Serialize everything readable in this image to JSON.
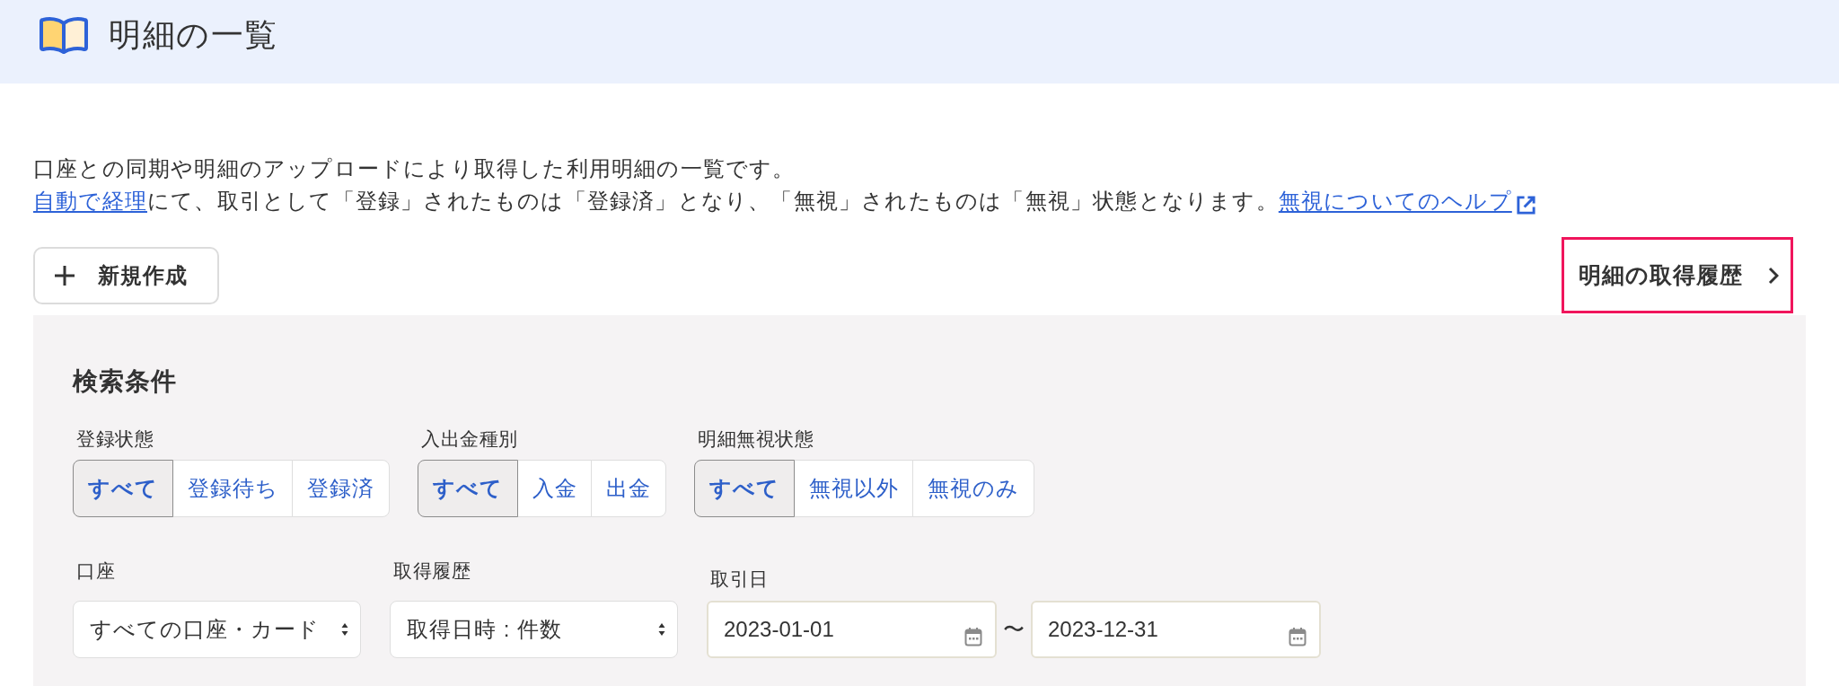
{
  "header": {
    "title": "明細の一覧"
  },
  "intro": {
    "lines": [
      [
        {
          "kind": "text",
          "text": "口座との同期や明細のアップロードにより取得した利用明細の一覧です。"
        }
      ],
      [
        {
          "kind": "link",
          "text": "自動で経理"
        },
        {
          "kind": "text",
          "text": "にて、取引として「登録」されたものは「登録済」となり、「無視」されたものは「無視」状態となります。"
        },
        {
          "kind": "external_link",
          "text": "無視についてのヘルプ"
        }
      ]
    ]
  },
  "actions": {
    "new_button": {
      "label": "新規作成"
    },
    "history_link": {
      "label": "明細の取得履歴",
      "highlighted": true
    }
  },
  "search": {
    "title": "検索条件",
    "filters": [
      {
        "label": "登録状態",
        "options": [
          {
            "label": "すべて",
            "selected": true
          },
          {
            "label": "登録待ち",
            "selected": false
          },
          {
            "label": "登録済",
            "selected": false
          }
        ]
      },
      {
        "label": "入出金種別",
        "options": [
          {
            "label": "すべて",
            "selected": true
          },
          {
            "label": "入金",
            "selected": false
          },
          {
            "label": "出金",
            "selected": false
          }
        ]
      },
      {
        "label": "明細無視状態",
        "options": [
          {
            "label": "すべて",
            "selected": true
          },
          {
            "label": "無視以外",
            "selected": false
          },
          {
            "label": "無視のみ",
            "selected": false
          }
        ]
      }
    ],
    "fields": [
      {
        "kind": "select",
        "label": "口座",
        "value": "すべての口座・カード"
      },
      {
        "kind": "select",
        "label": "取得履歴",
        "value": "取得日時 : 件数"
      },
      {
        "kind": "date_range",
        "label": "取引日",
        "from": "2023-01-01",
        "separator": "〜",
        "to": "2023-12-31"
      }
    ]
  }
}
